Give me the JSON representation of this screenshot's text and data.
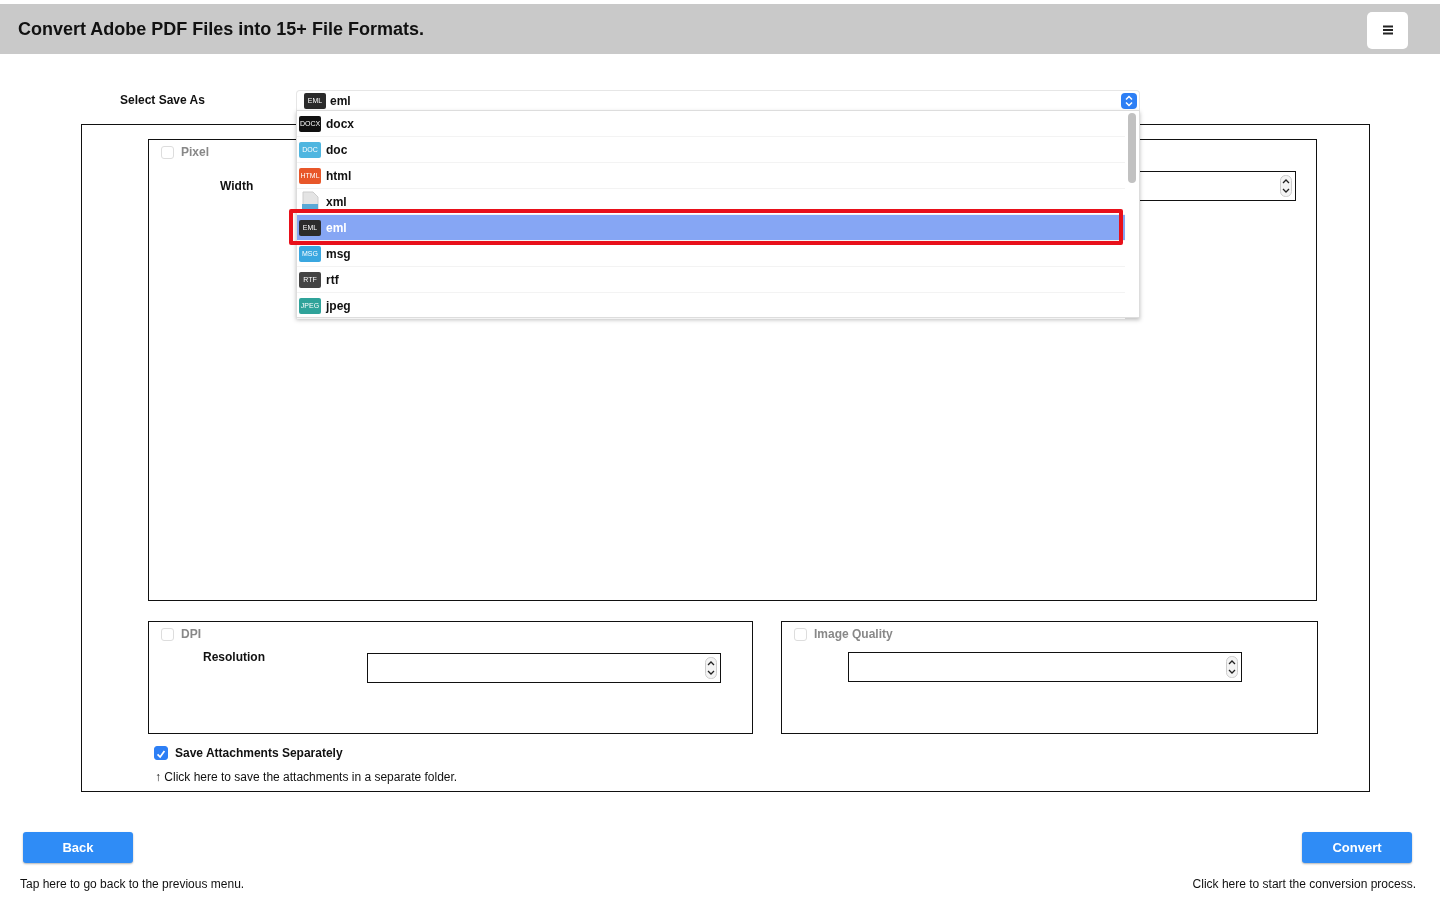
{
  "header": {
    "title": "Convert Adobe PDF Files into 15+ File Formats."
  },
  "save_as": {
    "label": "Select Save As",
    "value": {
      "label": "eml",
      "badge": "EML",
      "color": "#2b2b2b"
    },
    "options": [
      {
        "label": "docx",
        "badge": "DOCX",
        "color": "#111111",
        "selected": false
      },
      {
        "label": "doc",
        "badge": "DOC",
        "color": "#4fb6e0",
        "selected": false
      },
      {
        "label": "html",
        "badge": "HTML",
        "color": "#e8572a",
        "selected": false
      },
      {
        "label": "xml",
        "color": "#5aa9d6",
        "selected": false
      },
      {
        "label": "eml",
        "badge": "EML",
        "color": "#2b2b2b",
        "selected": true
      },
      {
        "label": "msg",
        "badge": "MSG",
        "color": "#3aa7e0",
        "selected": false
      },
      {
        "label": "rtf",
        "badge": "RTF",
        "color": "#444444",
        "selected": false
      },
      {
        "label": "jpeg",
        "badge": "JPEG",
        "color": "#2fa39a",
        "selected": false
      }
    ]
  },
  "pixel": {
    "label": "Pixel",
    "checked": false,
    "width_label": "Width"
  },
  "dpi": {
    "label": "DPI",
    "checked": false,
    "resolution_label": "Resolution"
  },
  "image_quality": {
    "label": "Image Quality",
    "checked": false
  },
  "attachments": {
    "label": "Save Attachments Separately",
    "checked": true,
    "hint": "↑ Click here to save the attachments in a separate folder."
  },
  "back": {
    "label": "Back",
    "hint": "Tap here to go back to the previous menu."
  },
  "convert": {
    "label": "Convert",
    "hint": "Click here to start the conversion process."
  }
}
